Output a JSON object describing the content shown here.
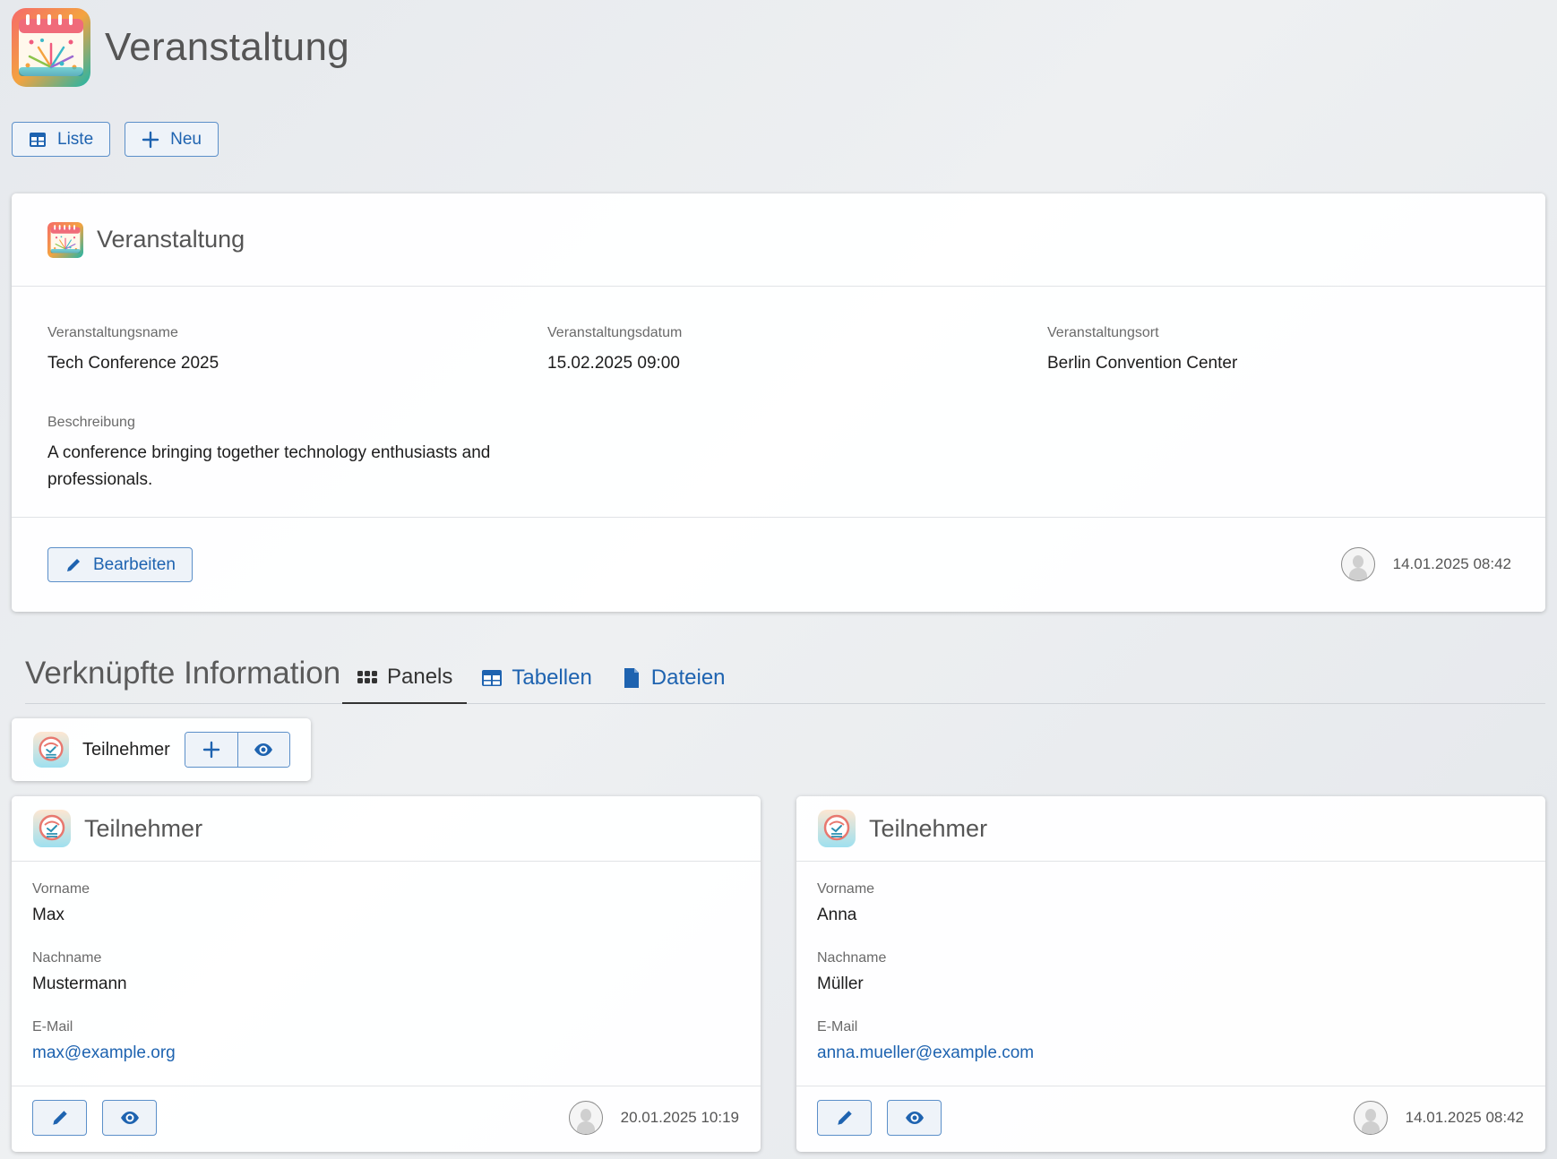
{
  "app": {
    "title": "Veranstaltung",
    "logo_icon": "calendar-fireworks-icon"
  },
  "toolbar": {
    "list_label": "Liste",
    "new_label": "Neu"
  },
  "record": {
    "title": "Veranstaltung",
    "fields": {
      "name": {
        "label": "Veranstaltungsname",
        "value": "Tech Conference 2025"
      },
      "date": {
        "label": "Veranstaltungsdatum",
        "value": "15.02.2025 09:00"
      },
      "location": {
        "label": "Veranstaltungsort",
        "value": "Berlin Convention Center"
      },
      "description": {
        "label": "Beschreibung",
        "value": "A conference bringing together technology enthusiasts and professionals."
      }
    },
    "edit_label": "Bearbeiten",
    "modified": "14.01.2025 08:42"
  },
  "related": {
    "title": "Verknüpfte Information",
    "tabs": [
      {
        "label": "Panels",
        "icon": "grid-dots-icon",
        "active": true
      },
      {
        "label": "Tabellen",
        "icon": "table-icon",
        "active": false
      },
      {
        "label": "Dateien",
        "icon": "file-icon",
        "active": false
      }
    ],
    "panel_chip": {
      "label": "Teilnehmer",
      "icon": "participant-icon"
    },
    "participants": [
      {
        "title": "Teilnehmer",
        "firstname_label": "Vorname",
        "firstname": "Max",
        "lastname_label": "Nachname",
        "lastname": "Mustermann",
        "email_label": "E-Mail",
        "email": "max@example.org",
        "modified": "20.01.2025 10:19"
      },
      {
        "title": "Teilnehmer",
        "firstname_label": "Vorname",
        "firstname": "Anna",
        "lastname_label": "Nachname",
        "lastname": "Müller",
        "email_label": "E-Mail",
        "email": "anna.mueller@example.com",
        "modified": "14.01.2025 08:42"
      }
    ]
  },
  "colors": {
    "accent": "#1e63b0",
    "accent_border": "#5b8fc9",
    "button_bg": "#eef3f9"
  }
}
